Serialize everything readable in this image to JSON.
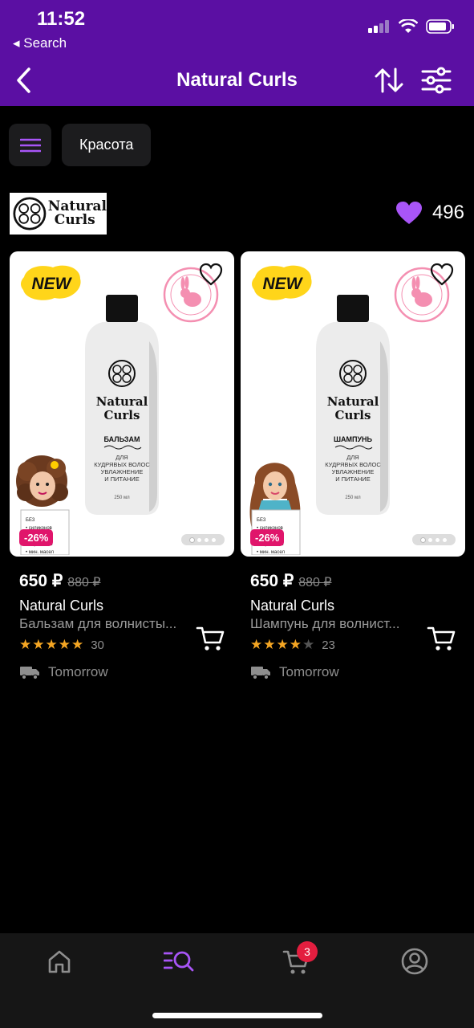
{
  "status": {
    "time": "11:52",
    "back_label": "◂ Search"
  },
  "nav": {
    "title": "Natural Curls"
  },
  "filters": {
    "chip_label": "Красота"
  },
  "brand": {
    "logo_line1": "Natural",
    "logo_line2": "Curls",
    "favorites_count": "496"
  },
  "products": [
    {
      "price": "650 ₽",
      "old_price": "880 ₽",
      "brand": "Natural Curls",
      "name": "Бальзам для волнисты...",
      "rating": 5,
      "reviews": "30",
      "discount": "-26%",
      "delivery": "Tomorrow",
      "bottle_type": "БАЛЬЗАМ"
    },
    {
      "price": "650 ₽",
      "old_price": "880 ₽",
      "brand": "Natural Curls",
      "name": "Шампунь для волнист...",
      "rating": 4,
      "reviews": "23",
      "discount": "-26%",
      "delivery": "Tomorrow",
      "bottle_type": "ШАМПУНЬ"
    }
  ],
  "tabbar": {
    "cart_badge": "3"
  },
  "colors": {
    "header": "#5b0fa3",
    "accent": "#a855f7",
    "star": "#f5a623",
    "discount": "#e0156b"
  }
}
